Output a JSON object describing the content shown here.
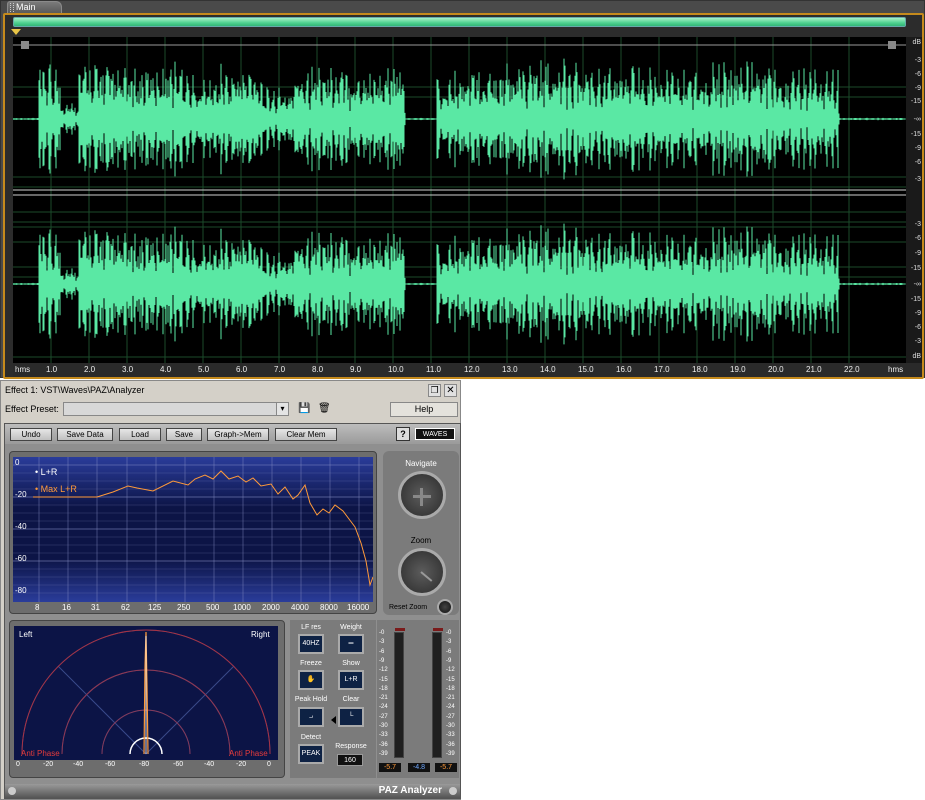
{
  "main": {
    "tab_label": "Main",
    "db_labels_top": [
      "dB",
      "-3",
      "-6",
      "-9",
      "-15",
      "-∞",
      "-15",
      "-9",
      "-6",
      "-3"
    ],
    "db_labels_bottom": [
      "-3",
      "-6",
      "-9",
      "-15",
      "-∞",
      "-15",
      "-9",
      "-6",
      "-3",
      "dB"
    ],
    "time_labels": [
      "hms",
      "1.0",
      "2.0",
      "3.0",
      "4.0",
      "5.0",
      "6.0",
      "7.0",
      "8.0",
      "9.0",
      "10.0",
      "11.0",
      "12.0",
      "13.0",
      "14.0",
      "15.0",
      "16.0",
      "17.0",
      "18.0",
      "19.0",
      "20.0",
      "21.0",
      "22.0",
      "hms"
    ],
    "wave_color": "#5ae8a4",
    "accent_border": "#c58a1c"
  },
  "effect": {
    "title": "Effect 1: VST\\Waves\\PAZ\\Analyzer",
    "preset_label": "Effect Preset:",
    "help_label": "Help",
    "pin_icon": "❐",
    "close_icon": "✕",
    "dropdown_icon": "▾",
    "save_icon": "💾",
    "delete_icon": "🗑"
  },
  "paz": {
    "toolbar": {
      "undo": "Undo",
      "save_data": "Save Data",
      "load": "Load",
      "save": "Save",
      "graph_mem": "Graph->Mem",
      "clear_mem": "Clear Mem",
      "help": "?",
      "logo": "WAVES"
    },
    "freq": {
      "y_labels": [
        "0",
        "-20",
        "-40",
        "-60",
        "-80"
      ],
      "x_labels": [
        "8",
        "16",
        "31",
        "62",
        "125",
        "250",
        "500",
        "1000",
        "2000",
        "4000",
        "8000",
        "16000"
      ],
      "legend_lr": "• L+R",
      "legend_max": "• Max L+R",
      "curve_color": "#ff9a3a"
    },
    "nav": {
      "navigate": "Navigate",
      "zoom": "Zoom",
      "reset_zoom": "Reset Zoom"
    },
    "stereo": {
      "left": "Left",
      "right": "Right",
      "anti_phase_left": "Anti Phase",
      "anti_phase_right": "Anti Phase",
      "x_labels": [
        "0",
        "-20",
        "-40",
        "-60",
        "-80",
        "-60",
        "-40",
        "-20",
        "0"
      ]
    },
    "controls": {
      "lf_res": "LF res",
      "lf_res_value": "40HZ",
      "weight": "Weight",
      "weight_icon": "═",
      "freeze": "Freeze",
      "freeze_icon": "✋",
      "show": "Show",
      "show_value": "L+R",
      "peak_hold": "Peak Hold",
      "peak_hold_icon": "⨼",
      "clear": "Clear",
      "clear_icon": "└",
      "detect": "Detect",
      "detect_value": "PEAK",
      "response": "Response",
      "response_value": "160"
    },
    "meters": {
      "scale": [
        "-0",
        "-3",
        "-6",
        "-9",
        "-12",
        "-15",
        "-18",
        "-21",
        "-24",
        "-27",
        "-30",
        "-33",
        "-36",
        "-39"
      ],
      "read_left": "-5.7",
      "read_mid": "-4.8",
      "read_right": "-5.7"
    },
    "footer_title": "PAZ Analyzer"
  }
}
